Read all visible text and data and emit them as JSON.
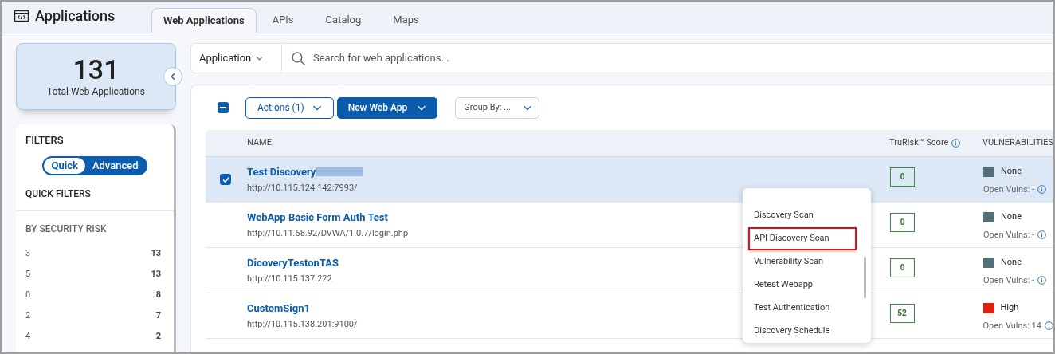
{
  "header": {
    "title": "Applications"
  },
  "tabs": [
    {
      "label": "Web Applications",
      "selected": true
    },
    {
      "label": "APIs",
      "selected": false
    },
    {
      "label": "Catalog",
      "selected": false
    },
    {
      "label": "Maps",
      "selected": false
    }
  ],
  "summary": {
    "count": "131",
    "label": "Total Web Applications"
  },
  "filters": {
    "title": "FILTERS",
    "modes": [
      {
        "label": "Quick",
        "selected": true
      },
      {
        "label": "Advanced",
        "selected": false
      }
    ],
    "quick_title": "QUICK FILTERS",
    "group_title": "BY SECURITY RISK",
    "items": [
      {
        "label": "3",
        "count": "13"
      },
      {
        "label": "5",
        "count": "13"
      },
      {
        "label": "0",
        "count": "8"
      },
      {
        "label": "2",
        "count": "7"
      },
      {
        "label": "4",
        "count": "2"
      }
    ]
  },
  "search": {
    "scope": "Application",
    "placeholder": "Search for web applications..."
  },
  "toolbar": {
    "select_all_indeterminate": true,
    "actions": "Actions (1)",
    "new": "New Web App",
    "group_by": "Group By: ..."
  },
  "table": {
    "columns": [
      "NAME",
      "TruRisk™ Score",
      "VULNERABILITIES"
    ],
    "rows": [
      {
        "name": "Test Discovery",
        "redacted": true,
        "url": "http://10.115.124.142:7993/",
        "score": "0",
        "severity": "None",
        "color": "#546e7a",
        "vulns": "Open Vulns: -",
        "selected": true
      },
      {
        "name": "WebApp Basic Form Auth Test",
        "redacted": false,
        "url": "http://10.11.68.92/DVWA/1.0.7/login.php",
        "score": "0",
        "severity": "None",
        "color": "#546e7a",
        "vulns": "Open Vulns: -",
        "selected": false
      },
      {
        "name": "DicoveryTestonTAS",
        "redacted": false,
        "url": "http://10.115.137.222",
        "score": "0",
        "severity": "None",
        "color": "#546e7a",
        "vulns": "Open Vulns: -",
        "selected": false
      },
      {
        "name": "CustomSign1",
        "redacted": false,
        "url": "http://10.115.138.201:9100/",
        "score": "52",
        "severity": "High",
        "color": "#e02010",
        "vulns": "Open Vulns: 14",
        "selected": false
      }
    ]
  },
  "menu": {
    "items": [
      {
        "label": "Discovery Scan",
        "highlighted": false
      },
      {
        "label": "API Discovery Scan",
        "highlighted": true
      },
      {
        "label": "Vulnerability Scan",
        "highlighted": false
      },
      {
        "label": "Retest Webapp",
        "highlighted": false
      },
      {
        "label": "Test Authentication",
        "highlighted": false
      },
      {
        "label": "Discovery Schedule",
        "highlighted": false
      }
    ]
  }
}
